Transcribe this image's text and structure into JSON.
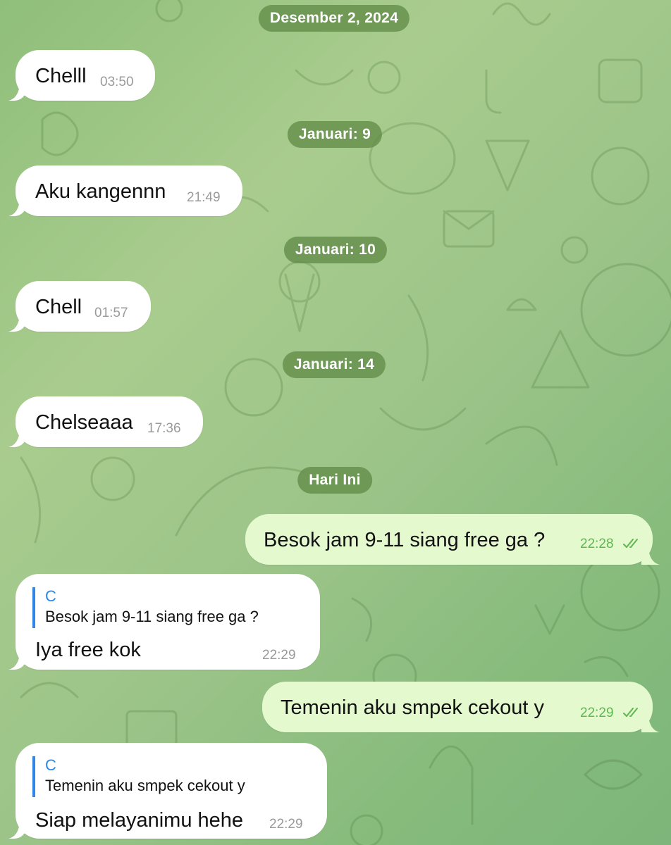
{
  "chat": {
    "date_separators": [
      "Desember 2, 2024",
      "Januari: 9",
      "Januari: 10",
      "Januari: 14",
      "Hari Ini"
    ],
    "messages": [
      {
        "direction": "incoming",
        "text": "Chelll",
        "time": "03:50"
      },
      {
        "direction": "incoming",
        "text": "Aku kangennn",
        "time": "21:49"
      },
      {
        "direction": "incoming",
        "text": "Chell",
        "time": "01:57"
      },
      {
        "direction": "incoming",
        "text": "Chelseaaa",
        "time": "17:36"
      },
      {
        "direction": "outgoing",
        "text": "Besok jam 9-11 siang free ga ?",
        "time": "22:28",
        "status": "read"
      },
      {
        "direction": "incoming",
        "text": "Iya free kok",
        "time": "22:29",
        "reply": {
          "sender": "C",
          "text": "Besok jam 9-11 siang free ga ?"
        }
      },
      {
        "direction": "outgoing",
        "text": "Temenin aku smpek cekout y",
        "time": "22:29",
        "status": "read"
      },
      {
        "direction": "incoming",
        "text": "Siap melayanimu hehe",
        "time": "22:29",
        "reply": {
          "sender": "C",
          "text": "Temenin aku smpek cekout y"
        }
      }
    ]
  },
  "colors": {
    "background": "#9cc489",
    "date_pill": "#628c48",
    "incoming_bubble": "#ffffff",
    "outgoing_bubble": "#e5f9cf",
    "outgoing_time": "#5db84f",
    "reply_accent": "#2f86e6"
  },
  "icons": {
    "read_status": "double-check-icon",
    "wallpaper": "doodle-pattern"
  }
}
